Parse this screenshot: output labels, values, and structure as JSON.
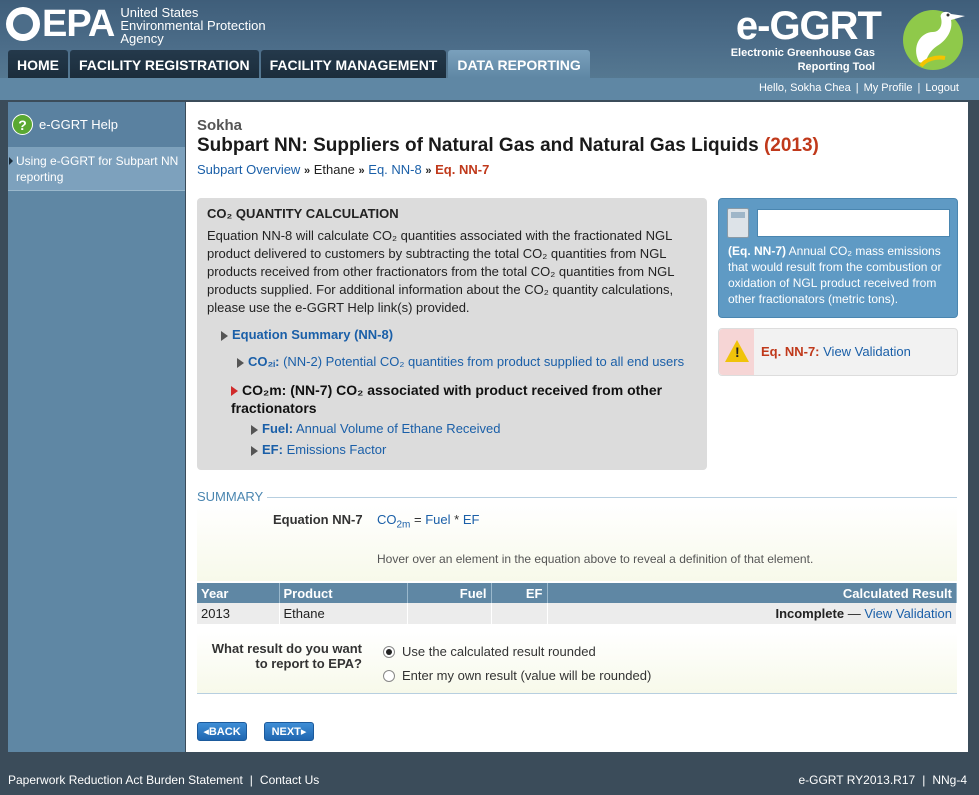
{
  "header": {
    "agency_line1": "United States",
    "agency_line2": "Environmental Protection",
    "agency_line3": "Agency",
    "epa_wordmark": "EPA",
    "egg_title": "e-GGRT",
    "egg_sub1": "Electronic Greenhouse Gas",
    "egg_sub2": "Reporting Tool"
  },
  "nav": {
    "tabs": [
      {
        "label": "HOME"
      },
      {
        "label": "FACILITY REGISTRATION"
      },
      {
        "label": "FACILITY MANAGEMENT"
      },
      {
        "label": "DATA REPORTING"
      }
    ],
    "active": "DATA REPORTING"
  },
  "userbar": {
    "greeting": "Hello, Sokha Chea",
    "profile": "My Profile",
    "logout": "Logout"
  },
  "sidebar": {
    "help_title": "e-GGRT Help",
    "help_link": "Using e-GGRT for Subpart NN reporting"
  },
  "main": {
    "facility": "Sokha",
    "title": "Subpart NN: Suppliers of Natural Gas and Natural Gas Liquids",
    "year": "(2013)",
    "breadcrumb": {
      "overview": "Subpart Overview",
      "ethane": "Ethane",
      "eq_nn8": "Eq. NN-8",
      "current": "Eq. NN-7"
    },
    "calc": {
      "heading": "CO₂ QUANTITY CALCULATION",
      "description": "Equation NN-8 will calculate CO₂ quantities associated with the fractionated NGL product delivered to customers by subtracting the total CO₂ quantities from NGL products received from other fractionators from the total CO₂ quantities from NGL products supplied. For additional information about the CO₂ quantity calculations, please use the e-GGRT Help link(s) provided.",
      "summary_link": "Equation Summary (NN-8)",
      "co2i_var": "CO₂ᵢ:",
      "co2i_text": "(NN-2) Potential CO₂ quantities from product supplied to all end users",
      "co2m_var": "CO₂m:",
      "co2m_text": "(NN-7) CO₂ associated with product received from other fractionators",
      "fuel_var": "Fuel:",
      "fuel_text": "Annual Volume of Ethane Received",
      "ef_var": "EF:",
      "ef_text": "Emissions Factor"
    },
    "info": {
      "input_value": "",
      "desc_label": "(Eq. NN-7)",
      "desc_text": "Annual CO₂ mass emissions that would result from the combustion or oxidation of NGL product received from other fractionators (metric tons)."
    },
    "validation": {
      "label": "Eq. NN-7:",
      "link": "View Validation"
    },
    "summary": {
      "heading": "SUMMARY",
      "eqn_label": "Equation NN-7",
      "co2": "CO",
      "co2_sub": "2m",
      "equals": " = ",
      "fuel": "Fuel",
      "times": " * ",
      "ef": "EF",
      "hover_note": "Hover over an element in the equation above to reveal a definition of that element."
    },
    "table": {
      "headers": [
        "Year",
        "Product",
        "Fuel",
        "EF",
        "Calculated Result"
      ],
      "row": {
        "year": "2013",
        "product": "Ethane",
        "fuel": "",
        "ef": "",
        "status": "Incomplete",
        "dash": " — ",
        "link": "View Validation"
      }
    },
    "choice": {
      "question": "What result do you want to report to EPA?",
      "option1": "Use the calculated result rounded",
      "option2": "Enter my own result (value will be rounded)",
      "selected": "option1"
    },
    "buttons": {
      "back": "◂BACK",
      "next": "NEXT▸"
    }
  },
  "footer": {
    "paperwork": "Paperwork Reduction Act Burden Statement",
    "contact": "Contact Us",
    "version": "e-GGRT RY2013.R17",
    "page_id": "NNg-4"
  },
  "colors": {
    "header_bg": "#4c6d89",
    "accent_blue": "#5f87a4",
    "title_red": "#c0391b",
    "link_blue": "#1a5fa8"
  }
}
